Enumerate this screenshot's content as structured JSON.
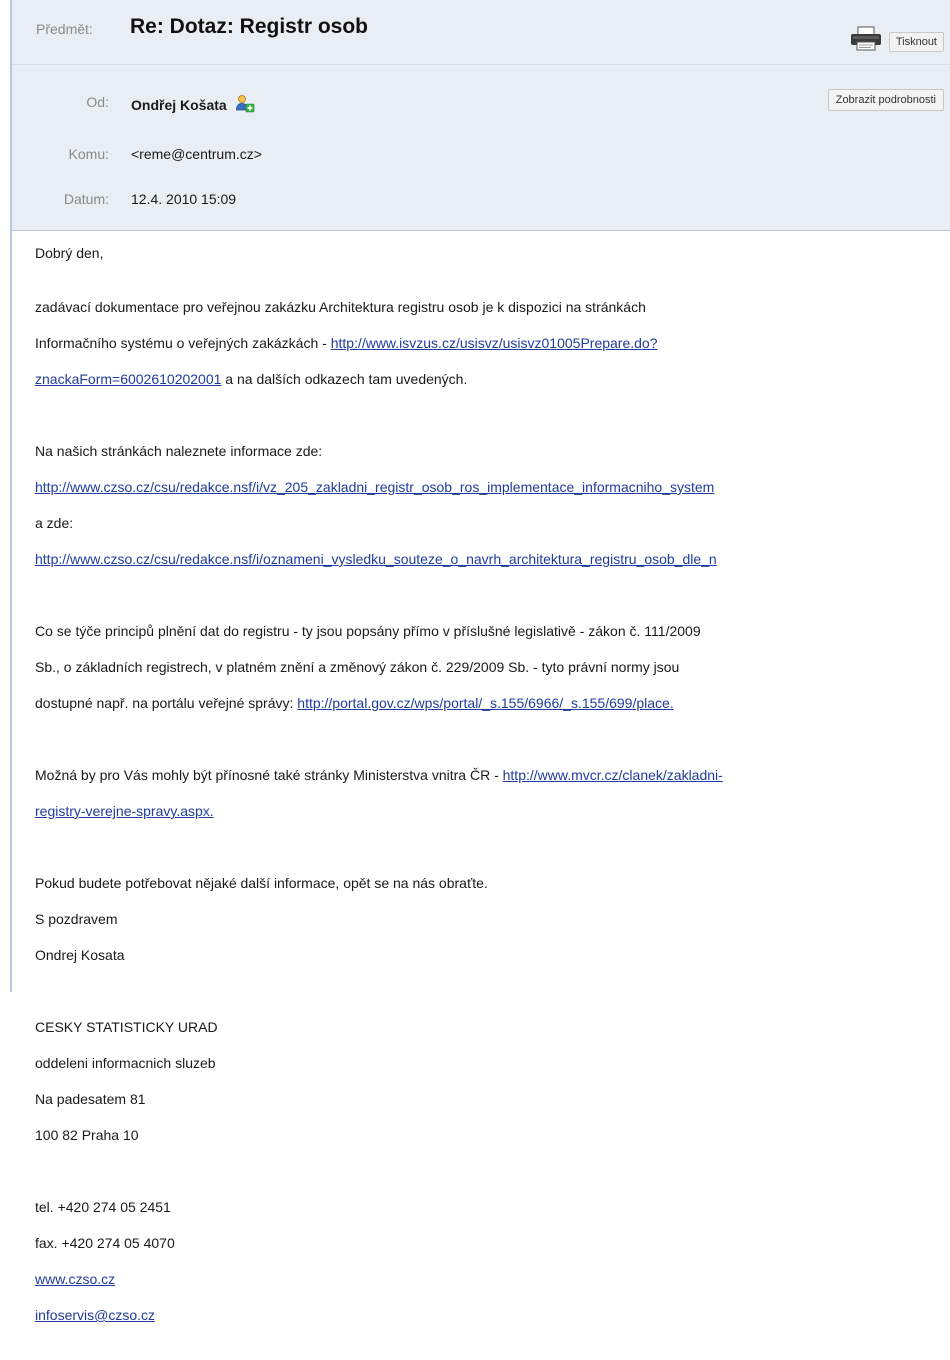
{
  "header": {
    "subject_label": "Předmět:",
    "subject": "Re: Dotaz: Registr osob",
    "print_label": "Tisknout",
    "from_label": "Od:",
    "from_name": "Ondřej Košata",
    "details_label": "Zobrazit podrobnosti",
    "to_label": "Komu:",
    "to_value": "<reme@centrum.cz>",
    "date_label": "Datum:",
    "date_value": "12.4. 2010 15:09"
  },
  "body": {
    "greeting": "Dobrý den,",
    "p1_a": "zadávací dokumentace pro veřejnou zakázku Architektura registru osob je k dispozici na stránkách",
    "p1_b": "Informačního systému o veřejných zakázkách - ",
    "p1_link_1": "http://www.isvzus.cz/usisvz/usisvz01005Prepare.do?",
    "p1_link_2": "znackaForm=6002610202001",
    "p1_c": " a na dalších odkazech tam uvedených.",
    "p2_a": "Na našich stránkách naleznete informace zde:",
    "p2_link_1": "http://www.czso.cz/csu/redakce.nsf/i/vz_205_zakladni_registr_osob_ros_implementace_informacniho_system",
    "p2_b": "a zde:",
    "p2_link_2": "http://www.czso.cz/csu/redakce.nsf/i/oznameni_vysledku_souteze_o_navrh_architektura_registru_osob_dle_n",
    "p3_a": "Co se týče principů plnění dat do registru - ty jsou popsány přímo v příslušné legislativě - zákon č. 111/2009",
    "p3_b": "Sb., o základních registrech, v platném znění a změnový zákon č. 229/2009 Sb. - tyto právní normy jsou",
    "p3_c": "dostupné např. na portálu veřejné správy: ",
    "p3_link": "http://portal.gov.cz/wps/portal/_s.155/6966/_s.155/699/place.",
    "p4_a": "Možná by pro Vás mohly být přínosné také stránky Ministerstva vnitra ČR - ",
    "p4_link_1": "http://www.mvcr.cz/clanek/zakladni-",
    "p4_link_2": "registry-verejne-spravy.aspx.",
    "p5_a": "Pokud budete potřebovat nějaké další informace, opět se na nás obraťte.",
    "p5_b": "S pozdravem",
    "p5_c": "Ondrej Kosata",
    "sig_org": "CESKY STATISTICKY URAD",
    "sig_dept": "oddeleni informacnich sluzeb",
    "sig_street": "Na padesatem 81",
    "sig_city": "100 82 Praha 10",
    "tel": "tel. +420 274 05 2451",
    "fax": "fax. +420 274 05 4070",
    "web": "www.czso.cz",
    "email": "infoservis@czso.cz"
  },
  "colors": {
    "header_bg": "#e9eef5",
    "link": "#1f3c9c",
    "label": "#8a8a8a"
  },
  "icons": {
    "print": "printer-icon",
    "add_contact": "add-contact-icon"
  }
}
